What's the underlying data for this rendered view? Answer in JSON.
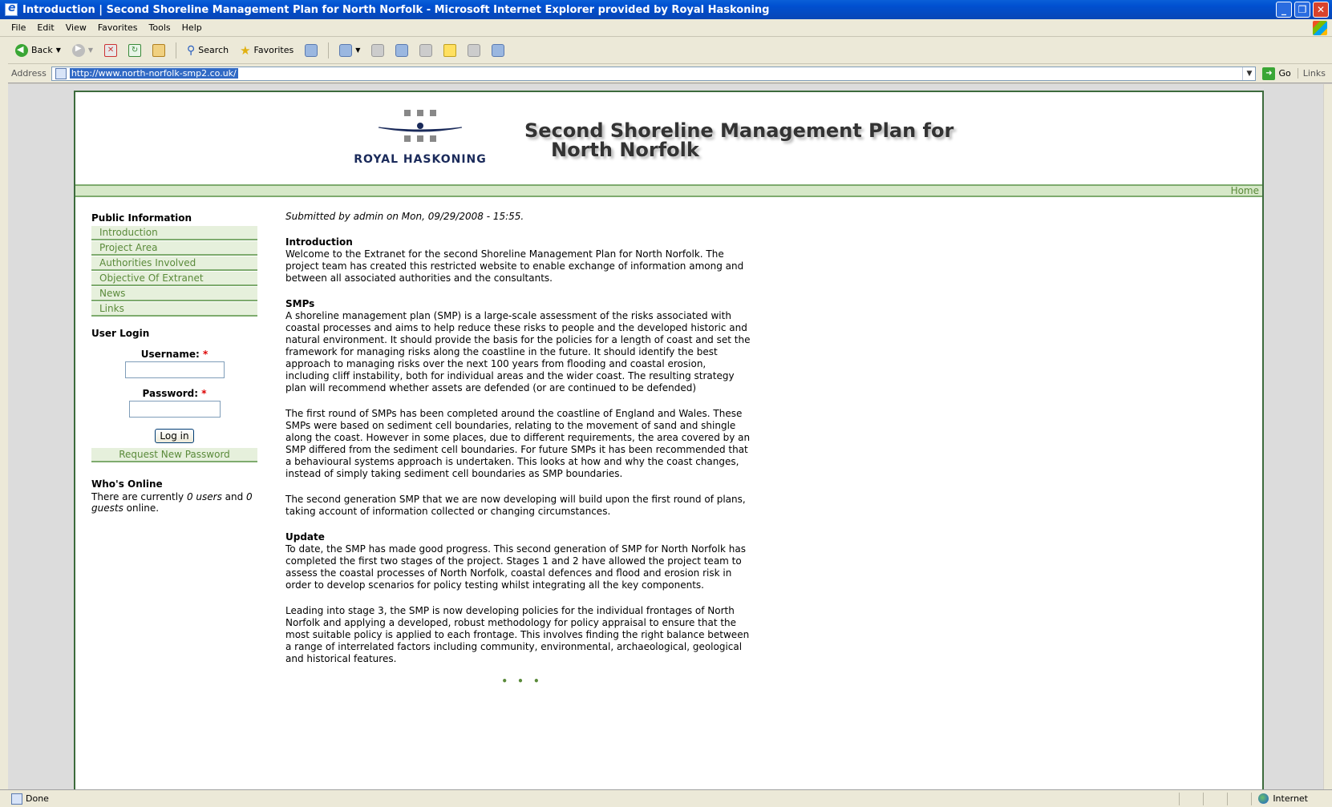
{
  "window": {
    "title": "Introduction | Second Shoreline Management Plan for North Norfolk - Microsoft Internet Explorer provided by Royal Haskoning"
  },
  "menubar": [
    "File",
    "Edit",
    "View",
    "Favorites",
    "Tools",
    "Help"
  ],
  "toolbar": {
    "back_label": "Back",
    "search_label": "Search",
    "favorites_label": "Favorites"
  },
  "address": {
    "label": "Address",
    "url": "http://www.north-norfolk-smp2.co.uk/",
    "go_label": "Go",
    "links_label": "Links"
  },
  "header": {
    "logo_text": "ROYAL HASKONING",
    "title_line1": "Second Shoreline Management Plan for",
    "title_line2": "North Norfolk"
  },
  "nav": {
    "home": "Home"
  },
  "sidebar": {
    "public_info_title": "Public Information",
    "menu": [
      "Introduction",
      "Project Area",
      "Authorities Involved",
      "Objective Of Extranet",
      "News",
      "Links"
    ],
    "login": {
      "title": "User Login",
      "username_label": "Username:",
      "password_label": "Password:",
      "required_mark": "*",
      "username_value": "",
      "password_value": "",
      "button_label": "Log in",
      "request_password": "Request New Password"
    },
    "online": {
      "title": "Who's Online",
      "text_prefix": "There are currently ",
      "users": "0 users",
      "text_and": " and ",
      "guests": "0 guests",
      "text_suffix": " online."
    }
  },
  "content": {
    "submitted": "Submitted by admin on Mon, 09/29/2008 - 15:55.",
    "intro_heading": "Introduction",
    "intro_text": "Welcome to the Extranet for the second Shoreline Management Plan for North Norfolk. The project team has created this restricted website to enable exchange of information among and between all associated authorities and the consultants.",
    "smps_heading": "SMPs",
    "smps_p1": "A shoreline management plan (SMP) is a large-scale assessment of the risks associated with coastal processes and aims to help reduce these risks to people and the developed historic and natural environment.  It should provide the basis for the policies for a length of coast and set the framework for managing risks along the coastline in the future.  It should identify the best approach to managing risks over the next 100 years from flooding and coastal erosion, including cliff instability, both for individual areas and the wider coast.  The resulting strategy plan will recommend whether assets are defended (or are continued to be defended)",
    "smps_p2": "The first round of SMPs has been completed around the coastline of England and Wales. These SMPs were based on sediment cell boundaries, relating to the movement of sand and shingle along the coast.  However in some places, due to different requirements, the area covered by an SMP differed from the sediment cell boundaries.  For future SMPs it has been recommended that a behavioural systems approach is undertaken.  This looks at how and why the coast changes, instead of simply taking sediment cell boundaries as SMP boundaries.",
    "smps_p3": "The second generation SMP that we are now developing will build upon the first round of plans, taking account of information collected or changing circumstances.",
    "update_heading": "Update",
    "update_p1": "To date, the SMP has made good progress. This second generation of SMP for North Norfolk has completed the first two stages of the project. Stages 1 and 2 have allowed the project team to assess the coastal processes of North Norfolk, coastal defences and flood and erosion risk in order to develop scenarios for policy testing whilst integrating all the key components.",
    "update_p2": "Leading into stage 3, the SMP is now developing policies for the individual frontages of North Norfolk and applying a developed, robust methodology for policy appraisal to ensure that the most suitable policy is applied to each frontage. This involves finding the right balance between a range of interrelated factors including community, environmental, archaeological, geological and historical features.",
    "dots": "• • •"
  },
  "status": {
    "text": "Done",
    "zone": "Internet"
  },
  "colors": {
    "accent_green": "#5a8a3a",
    "menu_bg": "#e6f0dc",
    "border_green": "#7eab6e",
    "titlebar_blue": "#0846b6"
  }
}
